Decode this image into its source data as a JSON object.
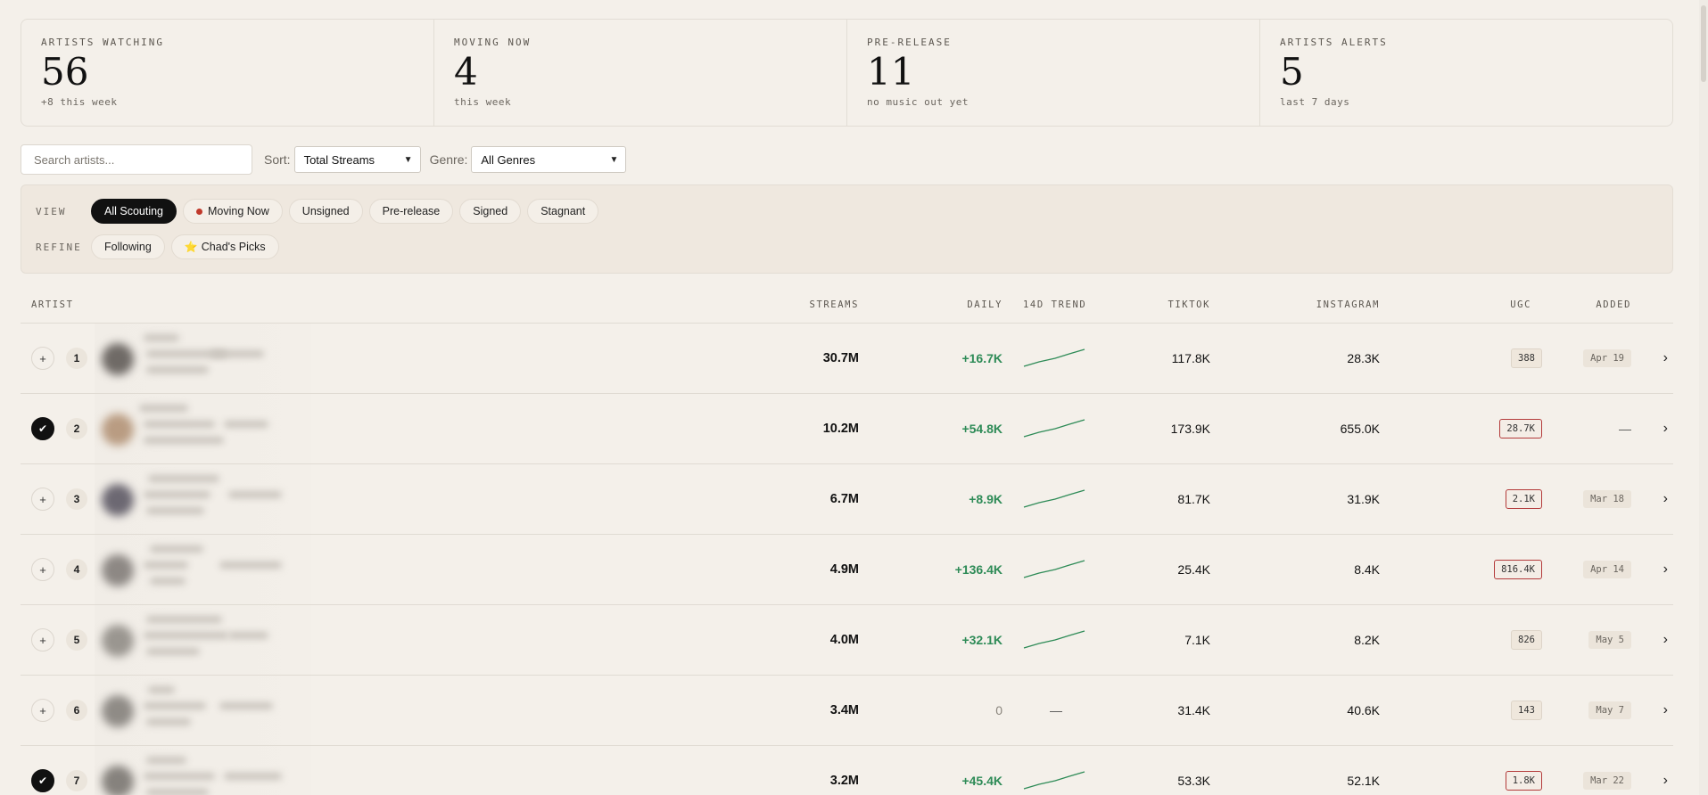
{
  "stats": [
    {
      "label": "ARTISTS WATCHING",
      "value": "56",
      "sub": "+8 this week"
    },
    {
      "label": "MOVING NOW",
      "value": "4",
      "sub": "this week"
    },
    {
      "label": "PRE-RELEASE",
      "value": "11",
      "sub": "no music out yet"
    },
    {
      "label": "ARTISTS ALERTS",
      "value": "5",
      "sub": "last 7 days"
    }
  ],
  "controls": {
    "search_placeholder": "Search artists...",
    "sort_label": "Sort:",
    "sort_value": "Total Streams",
    "genre_label": "Genre:",
    "genre_value": "All Genres"
  },
  "filters": {
    "view_label": "VIEW",
    "view_chips": [
      "All Scouting",
      "Moving Now",
      "Unsigned",
      "Pre-release",
      "Signed",
      "Stagnant"
    ],
    "refine_label": "REFINE",
    "refine_chips": [
      "Following",
      "Chad's Picks"
    ]
  },
  "table": {
    "headers": {
      "artist": "ARTIST",
      "streams": "STREAMS",
      "daily": "DAILY",
      "trend": "14D TREND",
      "tiktok": "TIKTOK",
      "instagram": "INSTAGRAM",
      "ugc": "UGC",
      "added": "ADDED"
    },
    "rows": [
      {
        "rank": "1",
        "following": false,
        "streams": "30.7M",
        "daily": "+16.7K",
        "trend": "up",
        "tiktok": "117.8K",
        "instagram": "28.3K",
        "ugc": "388",
        "ugc_hot": false,
        "added": "Apr 19",
        "avatar_color": "#6f6a66"
      },
      {
        "rank": "2",
        "following": true,
        "streams": "10.2M",
        "daily": "+54.8K",
        "trend": "up",
        "tiktok": "173.9K",
        "instagram": "655.0K",
        "ugc": "28.7K",
        "ugc_hot": true,
        "added": "—",
        "avatar_color": "#b99c82"
      },
      {
        "rank": "3",
        "following": false,
        "streams": "6.7M",
        "daily": "+8.9K",
        "trend": "up",
        "tiktok": "81.7K",
        "instagram": "31.9K",
        "ugc": "2.1K",
        "ugc_hot": true,
        "added": "Mar 18",
        "avatar_color": "#6c6872"
      },
      {
        "rank": "4",
        "following": false,
        "streams": "4.9M",
        "daily": "+136.4K",
        "trend": "up",
        "tiktok": "25.4K",
        "instagram": "8.4K",
        "ugc": "816.4K",
        "ugc_hot": true,
        "added": "Apr 14",
        "avatar_color": "#8d8884"
      },
      {
        "rank": "5",
        "following": false,
        "streams": "4.0M",
        "daily": "+32.1K",
        "trend": "up",
        "tiktok": "7.1K",
        "instagram": "8.2K",
        "ugc": "826",
        "ugc_hot": false,
        "added": "May 5",
        "avatar_color": "#9a9690"
      },
      {
        "rank": "6",
        "following": false,
        "streams": "3.4M",
        "daily": "0",
        "trend": "flat",
        "tiktok": "31.4K",
        "instagram": "40.6K",
        "ugc": "143",
        "ugc_hot": false,
        "added": "May 7",
        "avatar_color": "#8f8b86"
      },
      {
        "rank": "7",
        "following": true,
        "streams": "3.2M",
        "daily": "+45.4K",
        "trend": "up",
        "tiktok": "53.3K",
        "instagram": "52.1K",
        "ugc": "1.8K",
        "ugc_hot": true,
        "added": "Mar 22",
        "avatar_color": "#86827d"
      }
    ]
  },
  "colors": {
    "background": "#f4f0ea",
    "positive": "#2e8b57",
    "alert": "#b33a3a",
    "active_chip": "#111111",
    "moving_dot": "#c0392b"
  }
}
